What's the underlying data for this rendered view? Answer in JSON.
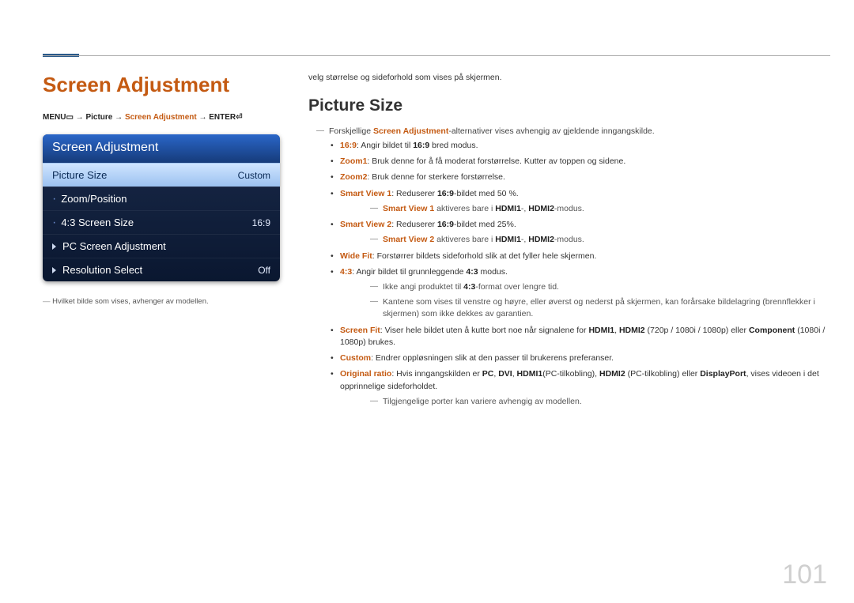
{
  "header": {
    "title": "Screen Adjustment",
    "path": {
      "menu": "MENU",
      "menu_icon": "▭",
      "arrow": " → ",
      "picture": "Picture",
      "screen_adj": "Screen Adjustment",
      "enter": "ENTER",
      "enter_icon": "⏎"
    }
  },
  "osd": {
    "title": "Screen Adjustment",
    "rows": [
      {
        "label": "Picture Size",
        "value": "Custom",
        "kind": "selected"
      },
      {
        "label": "Zoom/Position",
        "value": "",
        "kind": "dot"
      },
      {
        "label": "4:3 Screen Size",
        "value": "16:9",
        "kind": "dot"
      },
      {
        "label": "PC Screen Adjustment",
        "value": "",
        "kind": "tri"
      },
      {
        "label": "Resolution Select",
        "value": "Off",
        "kind": "tri"
      }
    ],
    "note": "Hvilket bilde som vises, avhenger av modellen."
  },
  "intro": "velg størrelse og sideforhold som vises på skjermen.",
  "section_title": "Picture Size",
  "top_dash": {
    "pre": "Forskjellige ",
    "kw": "Screen Adjustment",
    "post": "-alternativer vises avhengig av gjeldende inngangskilde."
  },
  "items": [
    {
      "kw": "16:9",
      "rest": ": Angir bildet til ",
      "mid_kw": "16:9",
      "tail": " bred modus."
    },
    {
      "kw": "Zoom1",
      "rest": ": Bruk denne for å få moderat forstørrelse. Kutter av toppen og sidene."
    },
    {
      "kw": "Zoom2",
      "rest": ": Bruk denne for sterkere forstørrelse."
    },
    {
      "kw": "Smart View 1",
      "rest": ": Reduserer ",
      "mid_kw": "16:9",
      "tail": "-bildet med 50 %.",
      "sub": {
        "kw": "Smart View 1",
        "rest": " aktiveres bare i ",
        "b1": "HDMI1",
        "sep": "-, ",
        "b2": "HDMI2",
        "end": "-modus."
      }
    },
    {
      "kw": "Smart View 2",
      "rest": ": Reduserer ",
      "mid_kw": "16:9",
      "tail": "-bildet med 25%.",
      "sub": {
        "kw": "Smart View 2",
        "rest": " aktiveres bare i ",
        "b1": "HDMI1",
        "sep": "-, ",
        "b2": "HDMI2",
        "end": "-modus."
      }
    },
    {
      "kw": "Wide Fit",
      "rest": ": Forstørrer bildets sideforhold slik at det fyller hele skjermen."
    },
    {
      "kw": "4:3",
      "rest": ": Angir bildet til grunnleggende ",
      "mid_kw": "4:3",
      "tail": " modus.",
      "sub2a": {
        "pre": "Ikke angi produktet til ",
        "b": "4:3",
        "post": "-format over lengre tid."
      },
      "sub2b": "Kantene som vises til venstre og høyre, eller øverst og nederst på skjermen, kan forårsake bildelagring (brennflekker i skjermen) som ikke dekkes av garantien."
    },
    {
      "kw": "Screen Fit",
      "rest": ": Viser hele bildet uten å kutte bort noe når signalene for ",
      "b1": "HDMI1",
      "c": ", ",
      "b2": "HDMI2",
      "paren": " (720p / 1080i / 1080p) eller ",
      "b3": "Component",
      "post": " (1080i / 1080p) brukes."
    },
    {
      "kw": "Custom",
      "rest": ": Endrer oppløsningen slik at den passer til brukerens preferanser."
    },
    {
      "kw": "Original ratio",
      "rest": ": Hvis inngangskilden er ",
      "b1": "PC",
      "c1": ", ",
      "b2": "DVI",
      "c2": ", ",
      "b3": "HDMI1",
      "p3": "(PC-tilkobling), ",
      "b4": "HDMI2",
      "p4": " (PC-tilkobling) eller ",
      "b5": "DisplayPort",
      "tail": ", vises videoen i det opprinnelige sideforholdet.",
      "sub3": "Tilgjengelige porter kan variere avhengig av modellen."
    }
  ],
  "page_number": "101"
}
